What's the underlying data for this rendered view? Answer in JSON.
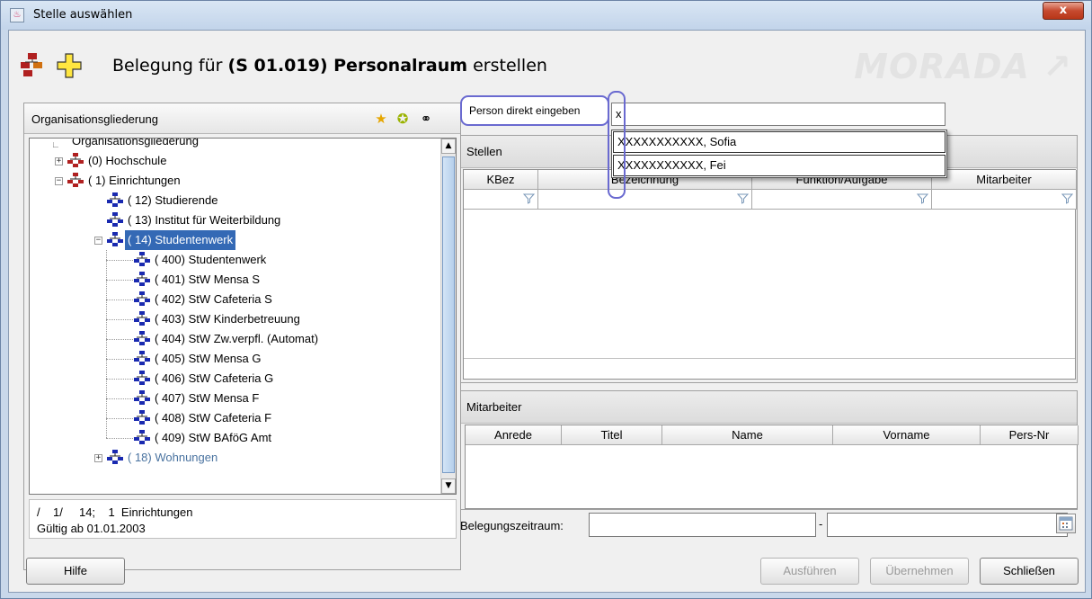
{
  "window": {
    "title": "Stelle auswählen",
    "close_label": "x"
  },
  "header": {
    "title_prefix": "Belegung für ",
    "title_bold": "(S 01.019) Personalraum",
    "title_suffix": " erstellen",
    "brand": "MORADA ↗"
  },
  "org_panel": {
    "title": "Organisationsgliederung",
    "tree": [
      {
        "label": "Organisationsgliederung",
        "level": 0,
        "muted": false
      },
      {
        "label": "(0) Hochschule",
        "level": 1,
        "expander": "+"
      },
      {
        "label": "(     1) Einrichtungen",
        "level": 1,
        "expander": "-"
      },
      {
        "label": "(     12) Studierende",
        "level": 2
      },
      {
        "label": "(     13) Institut für Weiterbildung",
        "level": 2
      },
      {
        "label": "(     14) Studentenwerk",
        "level": 2,
        "expander": "-",
        "selected": true
      },
      {
        "label": "(        400) Studentenwerk",
        "level": 3
      },
      {
        "label": "(        401) StW Mensa S",
        "level": 3
      },
      {
        "label": "(        402) StW Cafeteria S",
        "level": 3
      },
      {
        "label": "(        403) StW Kinderbetreuung",
        "level": 3
      },
      {
        "label": "(        404) StW Zw.verpfl. (Automat)",
        "level": 3
      },
      {
        "label": "(        405) StW Mensa G",
        "level": 3
      },
      {
        "label": "(        406) StW Cafeteria G",
        "level": 3
      },
      {
        "label": "(        407) StW Mensa F",
        "level": 3
      },
      {
        "label": "(        408) StW Cafeteria F",
        "level": 3
      },
      {
        "label": "(        409) StW BAföG Amt",
        "level": 3
      },
      {
        "label": "(     18) Wohnungen",
        "level": 2,
        "expander": "+",
        "muted": true
      }
    ],
    "status_line1": "/    1/     14;    1  Einrichtungen",
    "status_line2": "Gültig ab 01.01.2003"
  },
  "person": {
    "label": "Person direkt eingeben",
    "value": "x",
    "suggestions": [
      "XXXXXXXXXXX, Sofia",
      "XXXXXXXXXXX, Fei"
    ]
  },
  "stellen": {
    "title": "Stellen",
    "columns": [
      "KBez",
      "Bezeichnung",
      "Funktion/Aufgabe",
      "Mitarbeiter"
    ]
  },
  "mitarbeiter": {
    "title": "Mitarbeiter",
    "columns": [
      "Anrede",
      "Titel",
      "Name",
      "Vorname",
      "Pers-Nr"
    ]
  },
  "belegung": {
    "label": "Belegungszeitraum:",
    "dash": "-",
    "from": "",
    "to": ""
  },
  "buttons": {
    "help": "Hilfe",
    "execute": "Ausführen",
    "apply": "Übernehmen",
    "close": "Schließen"
  }
}
